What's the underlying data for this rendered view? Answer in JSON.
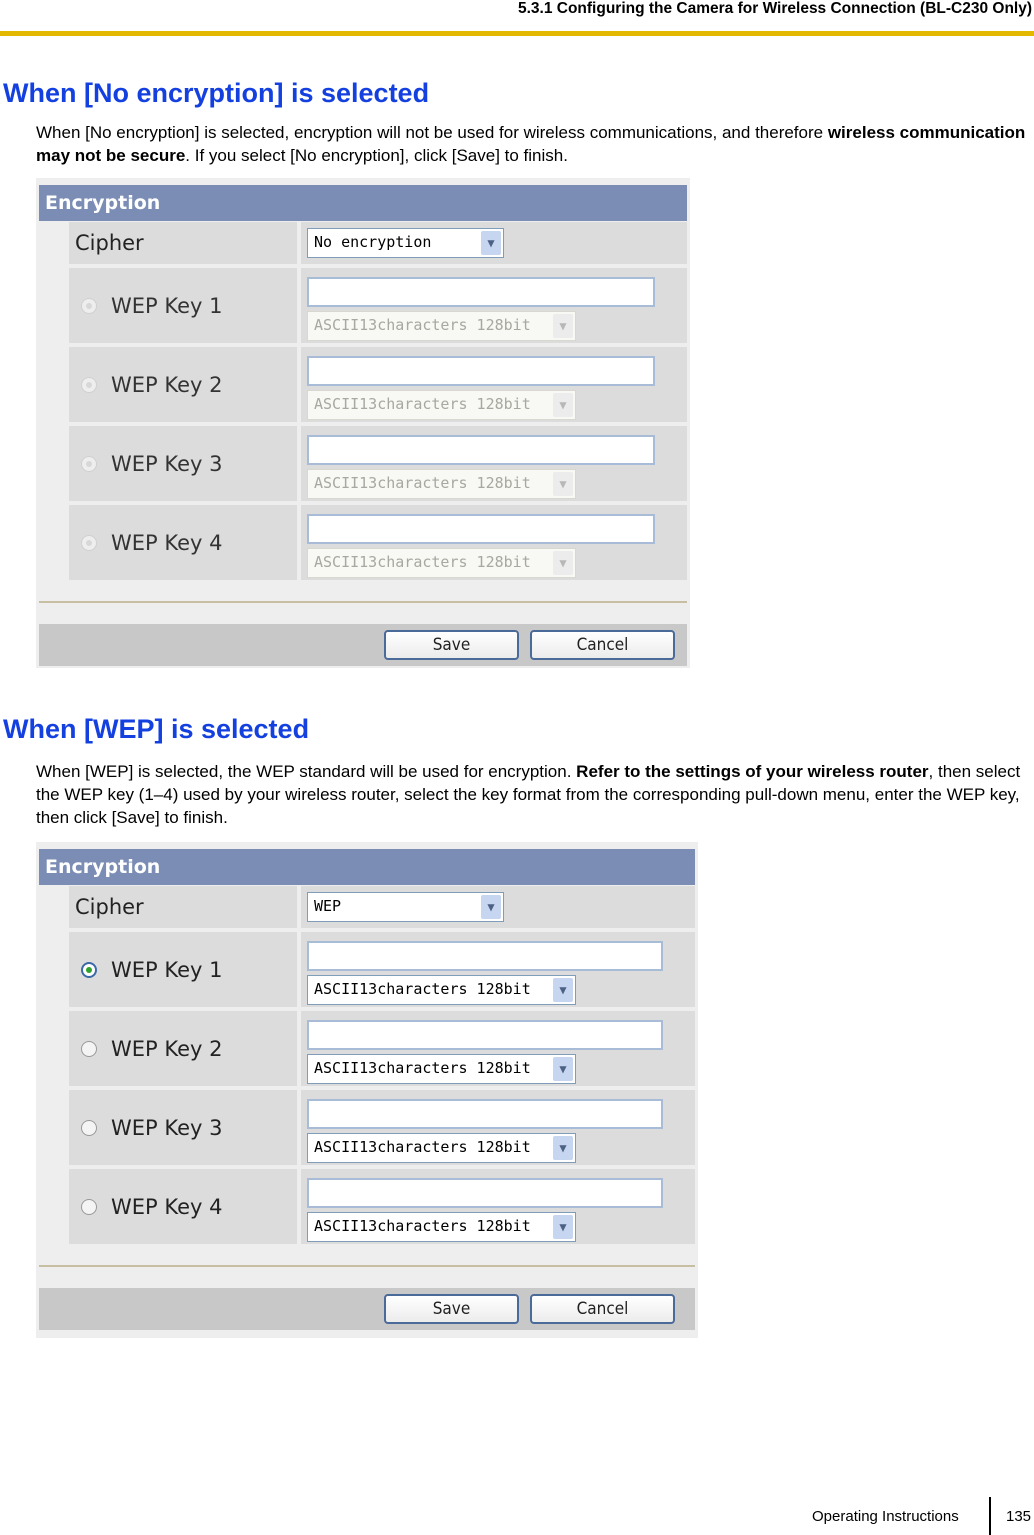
{
  "header": {
    "section_title": "5.3.1 Configuring the Camera for Wireless Connection (BL-C230 Only)"
  },
  "sections": [
    {
      "heading": "When [No encryption] is selected",
      "para_parts": [
        "When [No encryption] is selected, encryption will not be used for wireless communications, and therefore ",
        "wireless communication may not be secure",
        ". If you select [No encryption], click [Save] to finish."
      ],
      "panel": {
        "title": "Encryption",
        "cipher_label": "Cipher",
        "cipher_value": "No encryption",
        "keys": [
          {
            "label": "WEP Key 1",
            "selected": true,
            "value": "",
            "format": "ASCII13characters 128bit"
          },
          {
            "label": "WEP Key 2",
            "selected": false,
            "value": "",
            "format": "ASCII13characters 128bit"
          },
          {
            "label": "WEP Key 3",
            "selected": false,
            "value": "",
            "format": "ASCII13characters 128bit"
          },
          {
            "label": "WEP Key 4",
            "selected": false,
            "value": "",
            "format": "ASCII13characters 128bit"
          }
        ],
        "disabled": true,
        "save_label": "Save",
        "cancel_label": "Cancel"
      }
    },
    {
      "heading": "When [WEP] is selected",
      "para_parts": [
        "When [WEP] is selected, the WEP standard will be used for encryption. ",
        "Refer to the settings of your wireless router",
        ", then select the WEP key (1–4) used by your wireless router, select the key format from the corresponding pull-down menu, enter the WEP key, then click [Save] to finish."
      ],
      "panel": {
        "title": "Encryption",
        "cipher_label": "Cipher",
        "cipher_value": "WEP",
        "keys": [
          {
            "label": "WEP Key 1",
            "selected": true,
            "value": "",
            "format": "ASCII13characters 128bit"
          },
          {
            "label": "WEP Key 2",
            "selected": false,
            "value": "",
            "format": "ASCII13characters 128bit"
          },
          {
            "label": "WEP Key 3",
            "selected": false,
            "value": "",
            "format": "ASCII13characters 128bit"
          },
          {
            "label": "WEP Key 4",
            "selected": false,
            "value": "",
            "format": "ASCII13characters 128bit"
          }
        ],
        "disabled": false,
        "save_label": "Save",
        "cancel_label": "Cancel"
      }
    }
  ],
  "footer": {
    "doc_name": "Operating Instructions",
    "page_number": "135"
  },
  "icons": {
    "dropdown": "▼"
  }
}
